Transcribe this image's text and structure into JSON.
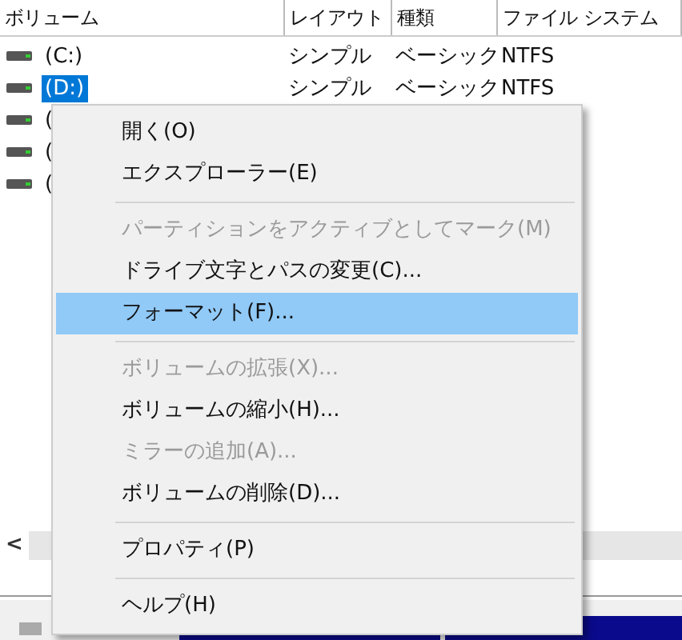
{
  "table": {
    "columns": [
      "ボリューム",
      "レイアウト",
      "種類",
      "ファイル システム"
    ],
    "rows": [
      {
        "volume": "(C:)",
        "layout": "シンプル",
        "type": "ベーシック",
        "file_system": "NTFS",
        "selected": false
      },
      {
        "volume": "(D:)",
        "layout": "シンプル",
        "type": "ベーシック",
        "file_system": "NTFS",
        "selected": true
      },
      {
        "volume": "(",
        "selected": false
      },
      {
        "volume": "(",
        "selected": false
      },
      {
        "volume": "(",
        "selected": false
      }
    ]
  },
  "scroll_left": "<",
  "context_menu": [
    {
      "kind": "item",
      "label": "開く(O)",
      "disabled": false,
      "selected": false
    },
    {
      "kind": "item",
      "label": "エクスプローラー(E)",
      "disabled": false,
      "selected": false
    },
    {
      "kind": "separator"
    },
    {
      "kind": "item",
      "label": "パーティションをアクティブとしてマーク(M)",
      "disabled": true,
      "selected": false
    },
    {
      "kind": "item",
      "label": "ドライブ文字とパスの変更(C)...",
      "disabled": false,
      "selected": false
    },
    {
      "kind": "item",
      "label": "フォーマット(F)...",
      "disabled": false,
      "selected": true
    },
    {
      "kind": "separator"
    },
    {
      "kind": "item",
      "label": "ボリュームの拡張(X)...",
      "disabled": true,
      "selected": false
    },
    {
      "kind": "item",
      "label": "ボリュームの縮小(H)...",
      "disabled": false,
      "selected": false
    },
    {
      "kind": "item",
      "label": "ミラーの追加(A)...",
      "disabled": true,
      "selected": false
    },
    {
      "kind": "item",
      "label": "ボリュームの削除(D)...",
      "disabled": false,
      "selected": false
    },
    {
      "kind": "separator"
    },
    {
      "kind": "item",
      "label": "プロパティ(P)",
      "disabled": false,
      "selected": false
    },
    {
      "kind": "separator"
    },
    {
      "kind": "item",
      "label": "ヘルプ(H)",
      "disabled": false,
      "selected": false
    }
  ]
}
